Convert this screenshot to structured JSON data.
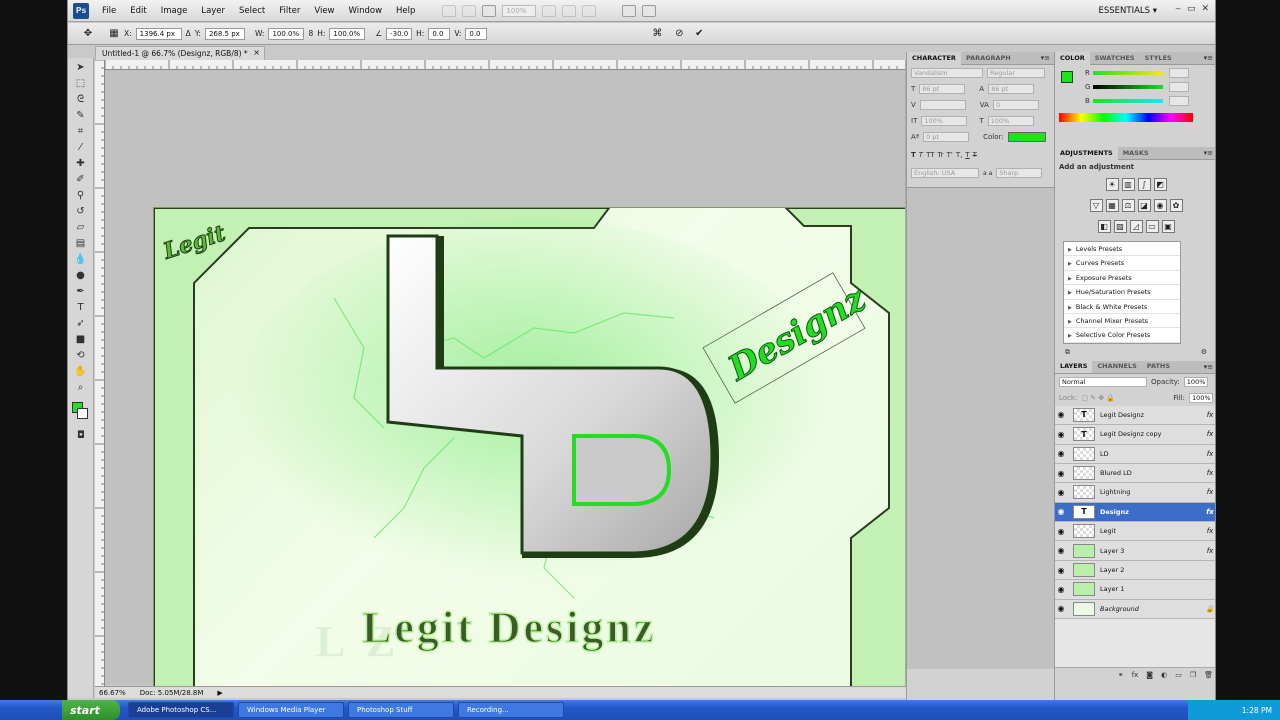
{
  "app": {
    "logo": "Ps",
    "menus": [
      "File",
      "Edit",
      "Image",
      "Layer",
      "Select",
      "Filter",
      "View",
      "Window",
      "Help"
    ],
    "zoom_value": "100%",
    "workspace": "ESSENTIALS",
    "window_controls": [
      "‒",
      "▭",
      "✕"
    ]
  },
  "options_bar": {
    "x_label": "X:",
    "x_value": "1396.4 px",
    "y_label": "Y:",
    "y_value": "268.5 px",
    "w_label": "W:",
    "w_value": "100.0%",
    "h_label": "H:",
    "h_value": "100.0%",
    "angle_value": "-30.0",
    "hskew_label": "H:",
    "hskew_value": "0.0",
    "vskew_label": "V:",
    "vskew_value": "0.0",
    "cancel_icon": "cancel-icon",
    "commit_icon": "check-icon"
  },
  "document": {
    "tab_title": "Untitled-1 @ 66.7% (Designz, RGB/8) *",
    "close": "×",
    "status_zoom": "66.67%",
    "status_doc": "Doc: 5.05M/28.8M"
  },
  "artwork": {
    "corner_tag": "Legit",
    "title": "Legit Designz",
    "title_shadow": "L                   Z",
    "tag_text": "Designz",
    "colors": {
      "accent": "#22dd22",
      "dark": "#1f3d14",
      "bg": "#e7fadd"
    }
  },
  "character_panel": {
    "tabs": [
      "CHARACTER",
      "PARAGRAPH"
    ],
    "font": "Vandalism",
    "style": "Regular",
    "size": "86 pt",
    "leading": "86 pt",
    "tracking": "0",
    "scale_v": "100%",
    "scale_h": "100%",
    "baseline": "0 pt",
    "color_label": "Color:",
    "color_value": "#1fe21f",
    "styles": [
      "T",
      "T",
      "TT",
      "Tr",
      "T'",
      "T,",
      "T",
      "T"
    ],
    "language": "English: USA",
    "aa_label": "a a",
    "aa_value": "Sharp"
  },
  "color_panel": {
    "tabs": [
      "COLOR",
      "SWATCHES",
      "STYLES"
    ],
    "r_label": "R",
    "g_label": "G",
    "b_label": "B",
    "r_value": "",
    "g_value": "",
    "b_value": ""
  },
  "adjustments_panel": {
    "tabs": [
      "ADJUSTMENTS",
      "MASKS"
    ],
    "heading": "Add an adjustment",
    "presets": [
      "Levels Presets",
      "Curves Presets",
      "Exposure Presets",
      "Hue/Saturation Presets",
      "Black & White Presets",
      "Channel Mixer Presets",
      "Selective Color Presets"
    ]
  },
  "layers_panel": {
    "tabs": [
      "LAYERS",
      "CHANNELS",
      "PATHS"
    ],
    "blend_mode": "Normal",
    "opacity_label": "Opacity:",
    "opacity_value": "100%",
    "lock_label": "Lock:",
    "fill_label": "Fill:",
    "fill_value": "100%",
    "layers": [
      {
        "name": "Legit Designz",
        "thumb": "T",
        "fx": "fx"
      },
      {
        "name": "Legit Designz copy",
        "thumb": "T",
        "fx": "fx"
      },
      {
        "name": "LD",
        "thumb": "",
        "fx": "fx"
      },
      {
        "name": "Blured LD",
        "thumb": "",
        "fx": "fx"
      },
      {
        "name": "Lightning",
        "thumb": "",
        "fx": "fx"
      },
      {
        "name": "Designz",
        "thumb": "T",
        "fx": "fx"
      },
      {
        "name": "Legit",
        "thumb": "",
        "fx": "fx"
      },
      {
        "name": "Layer 3",
        "thumb": "",
        "fx": "fx"
      },
      {
        "name": "Layer 2",
        "thumb": "",
        "fx": ""
      },
      {
        "name": "Layer 1",
        "thumb": "",
        "fx": ""
      },
      {
        "name": "Background",
        "thumb": "",
        "fx": "",
        "lock": "🔒"
      }
    ]
  },
  "taskbar": {
    "start": "start",
    "tasks": [
      "Adobe Photoshop CS...",
      "Windows Media Player",
      "Photoshop Stuff",
      "Recording..."
    ],
    "clock": "1:28 PM"
  }
}
